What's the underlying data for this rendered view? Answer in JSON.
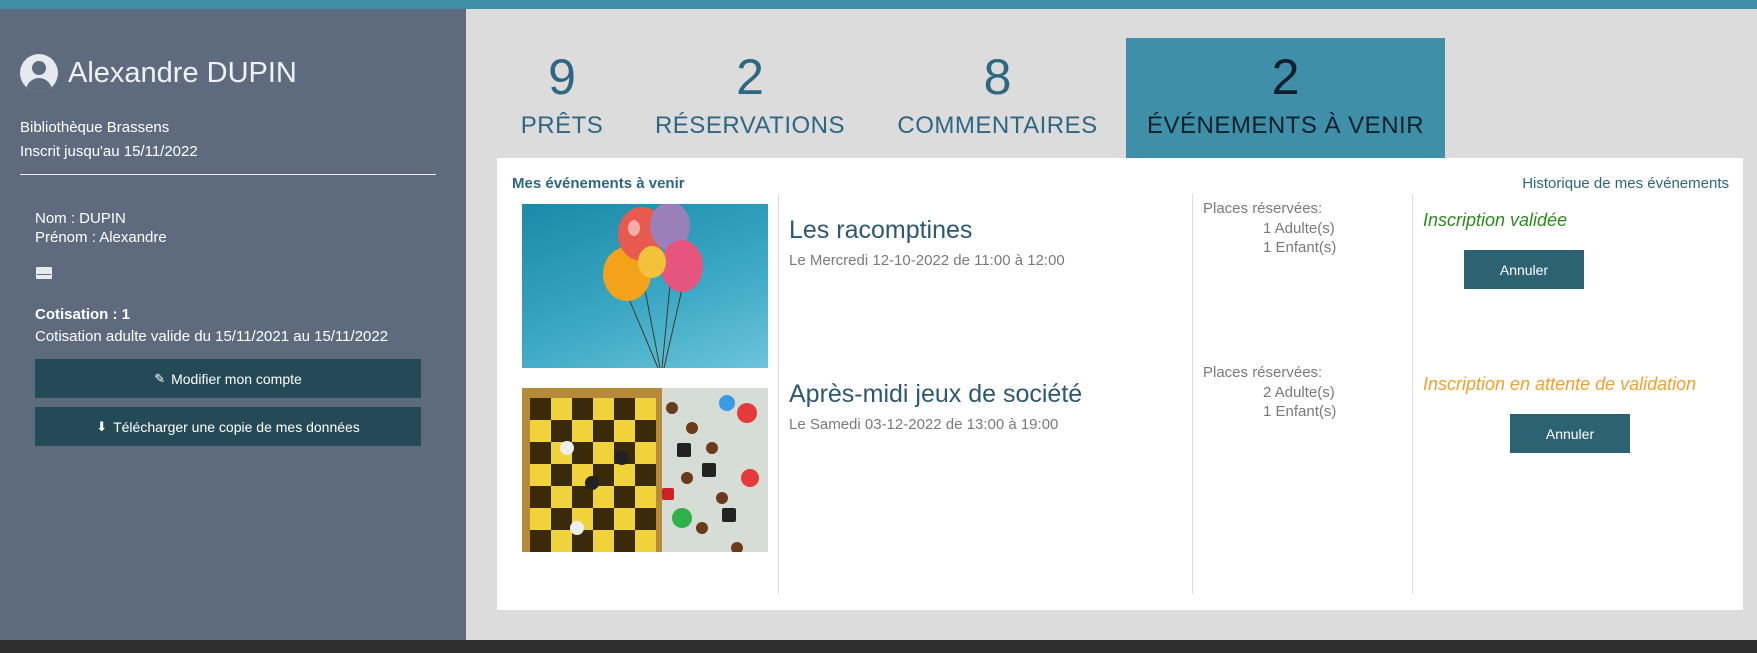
{
  "colors": {
    "top_bar": "#3f8fa9",
    "sidebar_bg": "#5e6b7f",
    "active_tab": "#3f8fa9",
    "button_dark": "#244a58",
    "status_validated": "#2e8a1e",
    "status_pending": "#f0a030"
  },
  "sidebar": {
    "user_name": "Alexandre DUPIN",
    "avatar_icon": "user-circle-icon",
    "library": "Bibliothèque Brassens",
    "member_until": "Inscrit jusqu'au 15/11/2022",
    "nom": "Nom : DUPIN",
    "prenom": "Prénom : Alexandre",
    "mail_icon": "envelope-icon",
    "cotisation_title": "Cotisation : 1",
    "cotisation_text": "Cotisation adulte valide du 15/11/2021 au 15/11/2022",
    "edit_button": {
      "label": "Modifier mon compte",
      "icon": "edit-icon"
    },
    "download_button": {
      "label": "Télécharger une copie de mes données",
      "icon": "download-icon"
    }
  },
  "tabs": [
    {
      "count": "9",
      "label": "PRÊTS",
      "active": false
    },
    {
      "count": "2",
      "label": "RÉSERVATIONS",
      "active": false
    },
    {
      "count": "8",
      "label": "COMMENTAIRES",
      "active": false
    },
    {
      "count": "2",
      "label": "ÉVÉNEMENTS À VENIR",
      "active": true
    }
  ],
  "panel": {
    "title": "Mes événements à venir",
    "history_link": "Historique de mes événements",
    "events": [
      {
        "image": "balloons-image",
        "title": "Les racomptines",
        "date": "Le Mercredi 12-10-2022 de 11:00 à 12:00",
        "places_label": "Places réservées:",
        "adults": "1 Adulte(s)",
        "children": "1 Enfant(s)",
        "status": "Inscription validée",
        "cancel_label": "Annuler"
      },
      {
        "image": "board-games-image",
        "title": "Après-midi jeux de société",
        "date": "Le Samedi 03-12-2022 de 13:00 à 19:00",
        "places_label": "Places réservées:",
        "adults": "2 Adulte(s)",
        "children": "1 Enfant(s)",
        "status": "Inscription en attente de validation",
        "cancel_label": "Annuler"
      }
    ]
  }
}
